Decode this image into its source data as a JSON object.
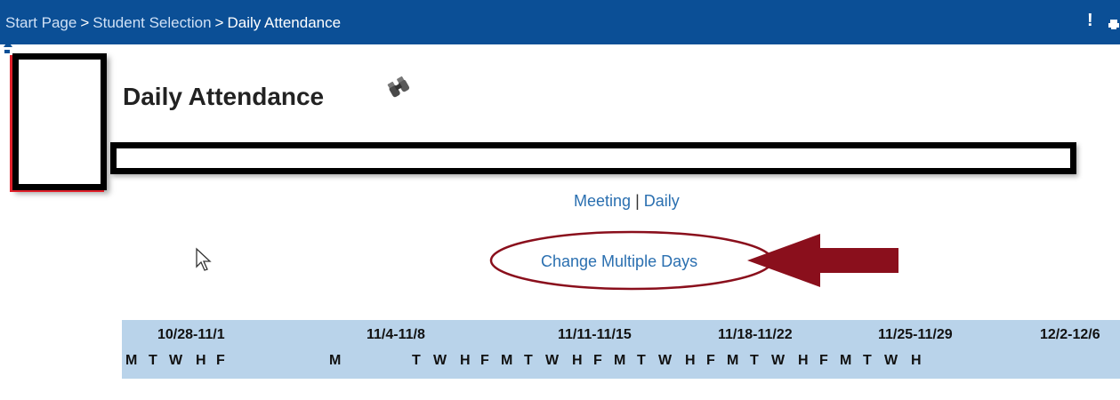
{
  "breadcrumb": {
    "items": [
      "Start Page",
      "Student Selection"
    ],
    "separator": ">",
    "current": "Daily Attendance"
  },
  "topbar_icons": {
    "alert": "!",
    "print": "printer-icon"
  },
  "page": {
    "title": "Daily Attendance"
  },
  "view_links": {
    "meeting": "Meeting",
    "separator": "|",
    "daily": "Daily"
  },
  "actions": {
    "change_multiple_days": "Change Multiple Days"
  },
  "calendar": {
    "weeks": [
      "10/28-11/1",
      "11/4-11/8",
      "11/11-11/15",
      "11/18-11/22",
      "11/25-11/29",
      "12/2-12/6"
    ],
    "days": [
      "M",
      "T",
      "W",
      "H",
      "F",
      "M",
      "T",
      "W",
      "H",
      "F",
      "M",
      "T",
      "W",
      "H",
      "F",
      "M",
      "T",
      "W",
      "H",
      "F",
      "M",
      "T",
      "W",
      "H",
      "F",
      "M",
      "T",
      "W",
      "H"
    ]
  },
  "colors": {
    "topbar": "#0b4f96",
    "link": "#2a6fb0",
    "calendar_header": "#b9d3ea",
    "annotation": "#8a0f1c"
  }
}
